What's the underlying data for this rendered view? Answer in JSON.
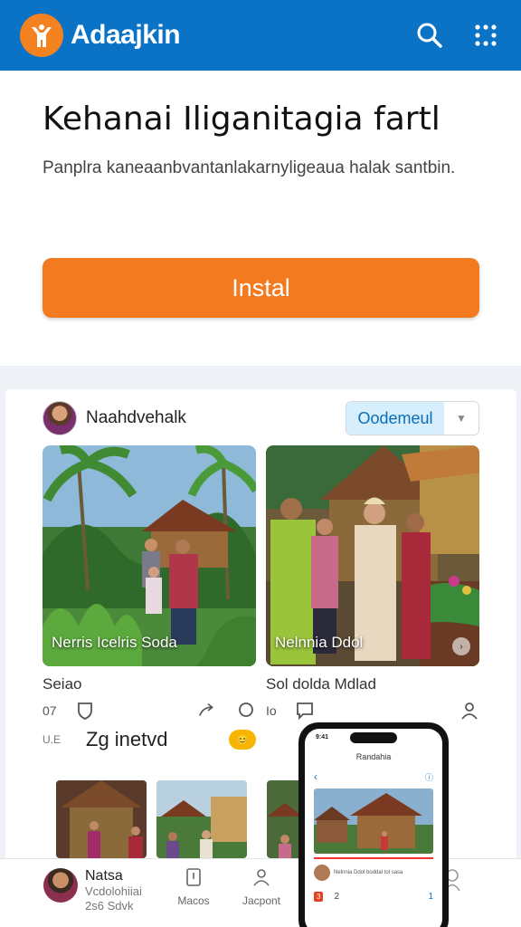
{
  "header": {
    "app_title": "Adaajkin",
    "logo_icon": "person-arms-up-icon",
    "search_icon": "search-icon",
    "menu_icon": "grid-dots-icon",
    "accent": "#0a73c6",
    "logo_color": "#f58220"
  },
  "hero": {
    "title": "Kehanai Iliganitagia fartl",
    "subtitle": "Panplra kaneaanbvantanlakarnyligeaua halak santbin.",
    "install_label": "Instal",
    "install_color": "#f47a1f"
  },
  "feed": {
    "profile_name": "Naahdvehalk",
    "follow_label": "Oodemeul",
    "posts": [
      {
        "caption": "Nerris Icelris Soda",
        "title": "Seiao",
        "stat1": "07",
        "views": "U.E",
        "views_label": "Zg inetvd",
        "emoji": "😊"
      },
      {
        "caption": "Nelnnia Ddol",
        "title": "Sol dolda Mdlad",
        "stat1": "Io"
      }
    ]
  },
  "bottom_nav": {
    "user_name": "Natsa",
    "user_line1": "Vcdolohiiai",
    "user_line2": "2s6 Sdvk",
    "item1_label": "Macos",
    "item2_label": "Jacpont"
  },
  "phone": {
    "time": "9:41",
    "title": "Randahia",
    "row_text": "Nelnnia Ddol boddal tol sasa",
    "count1": "3",
    "count2": "2",
    "count3": "1"
  }
}
